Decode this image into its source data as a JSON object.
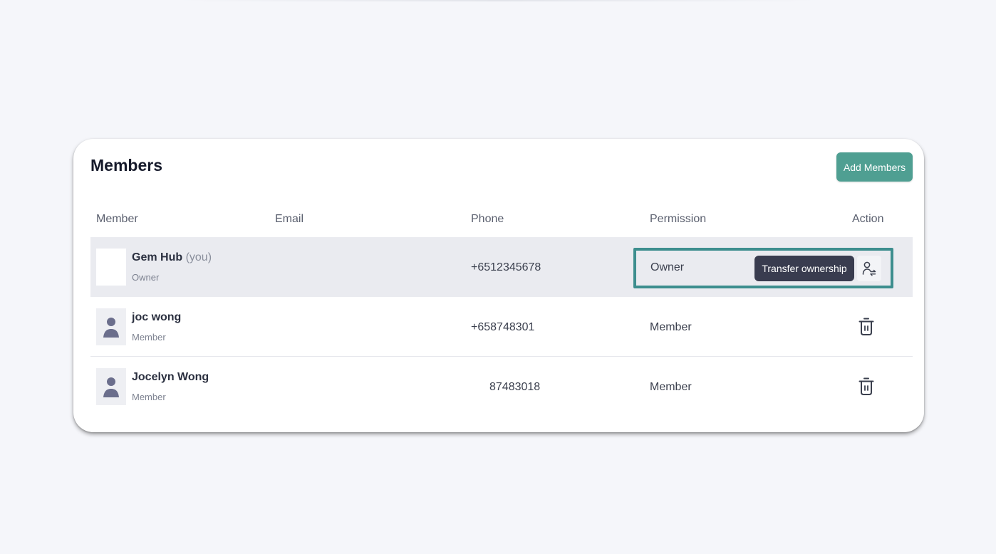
{
  "members_panel": {
    "title": "Members",
    "add_button_label": "Add Members",
    "columns": {
      "member": "Member",
      "email": "Email",
      "phone": "Phone",
      "permission": "Permission",
      "action": "Action"
    },
    "rows": [
      {
        "name": "Gem Hub",
        "you_suffix": "(you)",
        "role": "Owner",
        "email": "",
        "phone": "+6512345678",
        "permission": "Owner",
        "action_tooltip": "Transfer ownership",
        "action_icon": "transfer-ownership-icon"
      },
      {
        "name": "joc wong",
        "role": "Member",
        "email": "",
        "phone": "+658748301",
        "permission": "Member",
        "action_icon": "trash-icon"
      },
      {
        "name": "Jocelyn Wong",
        "role": "Member",
        "email": "",
        "phone": "87483018",
        "permission": "Member",
        "action_icon": "trash-icon"
      }
    ]
  },
  "colors": {
    "accent": "#4f9f92",
    "highlight_border": "#3d8e8e",
    "tooltip_bg": "#393c4f",
    "selected_row_bg": "#eaebf0"
  }
}
